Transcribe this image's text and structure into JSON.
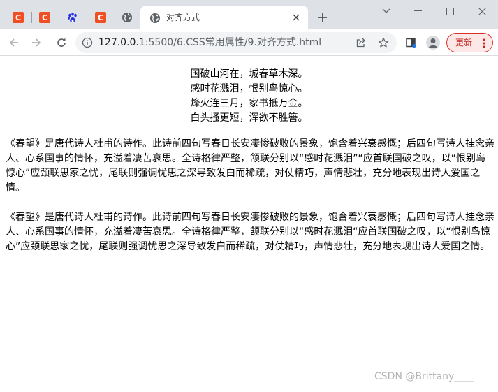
{
  "browser": {
    "pinned_tabs": [
      {
        "icon": "csdn-c-icon",
        "glyph": "C"
      },
      {
        "icon": "csdn-c-icon",
        "glyph": "C"
      },
      {
        "icon": "baidu-paw-icon"
      },
      {
        "icon": "csdn-c-icon",
        "glyph": "C"
      }
    ],
    "active_tab": {
      "title": "对齐方式",
      "icon": "globe-icon"
    },
    "url_host": "127.0.0.1",
    "url_path": ":5500/6.CSS常用属性/9.对齐方式.html",
    "update_label": "更新",
    "colors": {
      "tab_strip": "#dee1e6",
      "update_border": "#d93025",
      "csdn": "#f04f23"
    }
  },
  "page": {
    "poem": [
      "国破山河在，城春草木深。",
      "感时花溅泪，恨别鸟惊心。",
      "烽火连三月，家书抵万金。",
      "白头搔更短，浑欲不胜簪。"
    ],
    "paragraph_1": "《春望》是唐代诗人杜甫的诗作。此诗前四句写春日长安凄惨破败的景象，饱含着兴衰感慨；后四句写诗人挂念亲人、心系国事的情怀，充溢着凄苦哀思。全诗格律严整，颔联分别以“感时花溅泪”“应首联国破之叹，以“恨别鸟惊心”应颈联思家之忧，尾联则强调忧思之深导致发白而稀疏，对仗精巧，声情悲壮，充分地表现出诗人爱国之情。",
    "paragraph_2": "《春望》是唐代诗人杜甫的诗作。此诗前四句写春日长安凄惨破败的景象，饱含着兴衰感慨；后四句写诗人挂念亲人、心系国事的情怀，充溢着凄苦哀思。全诗格律严整，颔联分别以“感时花溅泪“应首联国破之叹，以“恨别鸟惊心”应颈联思家之忧，尾联则强调忧思之深导致发白而稀疏，对仗精巧，声情悲壮，充分地表现出诗人爱国之情。",
    "watermark": "CSDN @Brittany____"
  }
}
